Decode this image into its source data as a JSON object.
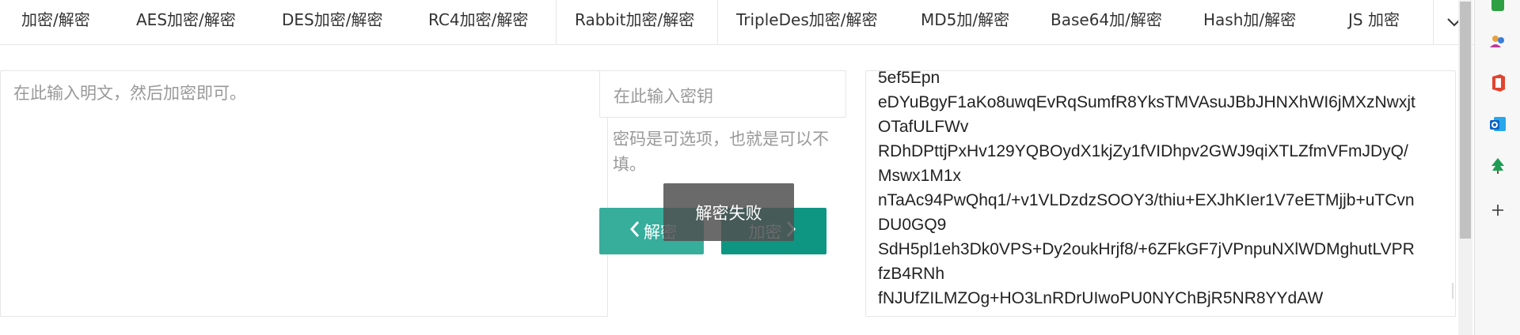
{
  "tabs": [
    {
      "label": "加密/解密"
    },
    {
      "label": "AES加密/解密"
    },
    {
      "label": "DES加密/解密"
    },
    {
      "label": "RC4加密/解密"
    },
    {
      "label": "Rabbit加密/解密"
    },
    {
      "label": "TripleDes加密/解密"
    },
    {
      "label": "MD5加/解密"
    },
    {
      "label": "Base64加/解密"
    },
    {
      "label": "Hash加/解密"
    },
    {
      "label": "JS 加密"
    }
  ],
  "plaintext": {
    "placeholder": "在此输入明文，然后加密即可。"
  },
  "key": {
    "placeholder": "在此输入密钥"
  },
  "hint": "密码是可选项，也就是可以不填。",
  "buttons": {
    "decrypt": "解密",
    "encrypt": "加密"
  },
  "toast": "解密失败",
  "output_lines": [
    "5ef5Epn",
    "eDYuBgyF1aKo8uwqEvRqSumfR8YksTMVAsuJBbJHNXhWI6jMXzNwxjt",
    "OTafULFWv",
    "RDhDPttjPxHv129YQBOydX1kjZy1fVIDhpv2GWJ9qiXTLZfmVFmJDyQ/",
    "Mswx1M1x",
    "nTaAc94PwQhq1/+v1VLDzdzSOOY3/thiu+EXJhKIer1V7eETMjjb+uTCvn",
    "DU0GQ9",
    "SdH5pl1eh3Dk0VPS+Dy2oukHrjf8/+6ZFkGF7jVPnpuNXlWDMghutLVPR",
    "fzB4RNh",
    "fNJUfZILMZOg+HO3LnRDrUIwoPU0NYChBjR5NR8YYdAW"
  ],
  "colors": {
    "decrypt_button": "#37ad9c",
    "encrypt_button": "#0f9683",
    "toast_bg": "#505050"
  },
  "sidebar_icons": [
    "copilot-icon",
    "people-icon",
    "office-icon",
    "outlook-icon",
    "tree-icon",
    "plus-icon"
  ]
}
